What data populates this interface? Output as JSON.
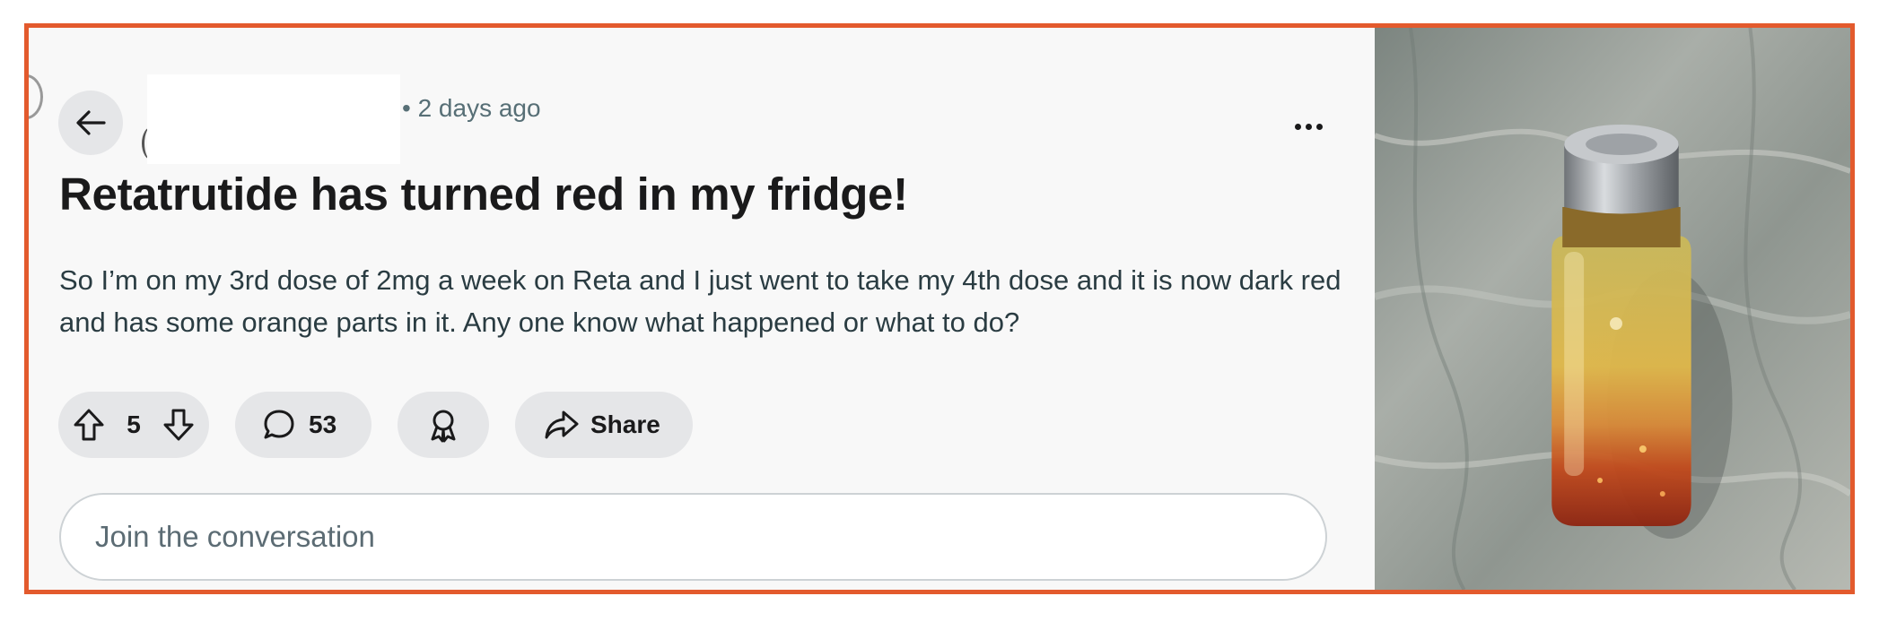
{
  "post": {
    "meta_time": "• 2 days ago",
    "title": "Retatrutide has turned red in my fridge!",
    "body": "So I’m on my 3rd dose of 2mg a week on Reta and I just went to take my 4th dose and it is now dark red and has some orange parts in it. Any one know what happened or what to do?"
  },
  "actions": {
    "vote_count": "5",
    "comment_count": "53",
    "share_label": "Share"
  },
  "reply": {
    "placeholder": "Join the conversation"
  },
  "icons": {
    "back": "back-arrow-icon",
    "more": "more-options-icon",
    "upvote": "upvote-arrow-icon",
    "downvote": "downvote-arrow-icon",
    "comment": "comment-bubble-icon",
    "award": "award-icon",
    "share": "share-arrow-icon"
  },
  "colors": {
    "frame_border": "#e35a2d",
    "post_background": "#f8f8f8",
    "pill_background": "#e5e6e8"
  }
}
